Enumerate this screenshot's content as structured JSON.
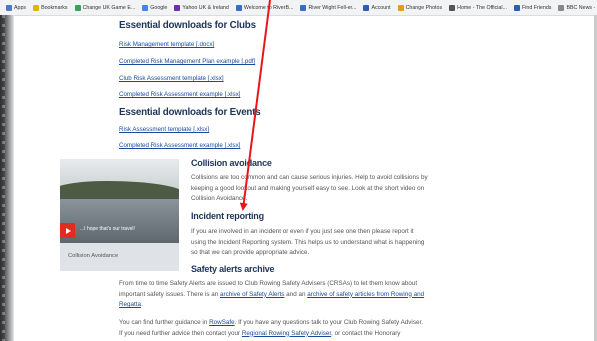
{
  "bookmarks": [
    {
      "label": "Apps",
      "color": "#4a79c8"
    },
    {
      "label": "Bookmarks",
      "color": "#e4b400"
    },
    {
      "label": "Change UK Game E...",
      "color": "#3ba15a"
    },
    {
      "label": "Google",
      "color": "#4285f4"
    },
    {
      "label": "Yahoo UK & Ireland",
      "color": "#6b2fb3"
    },
    {
      "label": "Welcome to RiverB...",
      "color": "#3a6dc4"
    },
    {
      "label": "River Wight Fell-er...",
      "color": "#3a6dc4"
    },
    {
      "label": "Account",
      "color": "#2b5fb5"
    },
    {
      "label": "Change Photos",
      "color": "#e89b19"
    },
    {
      "label": "Home - The Official...",
      "color": "#555555"
    },
    {
      "label": "Find Friends",
      "color": "#2b5fb5"
    },
    {
      "label": "BBC News - Home",
      "color": "#888888"
    }
  ],
  "bookmarks_overflow": "»",
  "bookmarks_other": "Other bookmarks",
  "clubs_heading": "Essential downloads for Clubs",
  "clubs_links": [
    "Risk Management template [.docx]",
    "Completed Risk Management Plan example [.pdf]",
    "Club Risk Assessment template [.xlsx]",
    "Completed Risk Assessment example [.xlsx]"
  ],
  "events_heading": "Essential downloads for Events",
  "events_links": [
    "Risk Assessment template [.xlsx]",
    "Completed Risk Assessment example [.xlsx]"
  ],
  "collision": {
    "heading": "Collision avoidance",
    "lines": [
      "Collisions are too common and can cause serious injuries. Help to avoid collisions by",
      "keeping a good lookout and making yourself easy to see. Look at the short video on",
      "Collision Avoidance."
    ]
  },
  "video": {
    "caption": "...I hope that's our travel!",
    "label": "Collision Avoidance"
  },
  "incident": {
    "heading": "Incident reporting",
    "lines": [
      "If you are involved in an incident or even if you just see one then please report it",
      "using the Incident Reporting system. This helps us to understand what is happening",
      "so that we can provide appropriate advice."
    ]
  },
  "alerts": {
    "heading": "Safety alerts archive",
    "p1_l1": "From time to time Safety Alerts are issued to Club Rowing Safety Advisers (CRSAs) to let them know about",
    "p1_l2a": "important safety issues. There is an ",
    "p1_l2_link1": "archive of Safety Alerts",
    "p1_l2b": " and an ",
    "p1_l2_link2": "archive of safety articles from Rowing and",
    "p1_l3_link": "Regatta",
    "p2_l1a": "You can find further guidance in ",
    "p2_l1_link": "RowSafe",
    "p2_l1b": ". If you have any questions talk to your Club Rowing Safety Adviser.",
    "p2_l2a": "If you need further advice then contact your ",
    "p2_l2_link": "Regional Rowing Safety Adviser",
    "p2_l2b": ", or contact the Honorary"
  },
  "colors": {
    "heading": "#1d3557",
    "link": "#1a4a9a",
    "arrow": "#e8161c",
    "play": "#e32b22"
  }
}
